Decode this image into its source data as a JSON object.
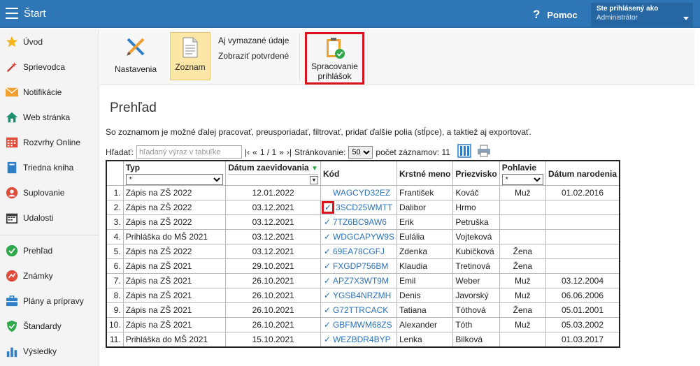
{
  "header": {
    "title": "Štart",
    "help_label": "Pomoc",
    "user_label": "Ste prihlásený ako",
    "user_name": "Administrátor"
  },
  "sidebar": {
    "items": [
      {
        "label": "Úvod",
        "icon": "star-icon"
      },
      {
        "label": "Sprievodca",
        "icon": "magic-wand-icon"
      },
      {
        "label": "Notifikácie",
        "icon": "envelope-icon"
      },
      {
        "label": "Web stránka",
        "icon": "house-icon"
      },
      {
        "label": "Rozvrhy Online",
        "icon": "timetable-icon"
      },
      {
        "label": "Triedna kniha",
        "icon": "book-icon"
      },
      {
        "label": "Suplovanie",
        "icon": "substitute-person-icon"
      },
      {
        "label": "Udalosti",
        "icon": "calendar-icon"
      },
      {
        "label": "Prehľad",
        "icon": "check-circle-icon"
      },
      {
        "label": "Známky",
        "icon": "grades-icon"
      },
      {
        "label": "Plány a prípravy",
        "icon": "briefcase-icon"
      },
      {
        "label": "Štandardy",
        "icon": "shield-check-icon"
      },
      {
        "label": "Výsledky",
        "icon": "bar-chart-icon"
      }
    ]
  },
  "toolbar": {
    "settings_label": "Nastavenia",
    "list_label": "Zoznam",
    "link_deleted": "Aj vymazané údaje",
    "link_confirmed": "Zobraziť potvrdené",
    "processing_line1": "Spracovanie",
    "processing_line2": "prihlášok"
  },
  "main": {
    "title": "Prehľad",
    "description": "So zoznamom je možné ďalej pracovať, preusporiadať, filtrovať, pridať ďalšie polia (stĺpce), a taktiež aj exportovať.",
    "search_label": "Hľadať:",
    "search_placeholder": "hľadaný výraz v tabuľke",
    "pager_first": "|‹",
    "pager_prev": "«",
    "pager_text": "1 / 1",
    "pager_next": "»",
    "pager_last": "›|",
    "page_size_label": "Stránkovanie:",
    "page_size_value": "50",
    "record_count_label": "počet záznamov: 11"
  },
  "table": {
    "headers": {
      "typ": "Typ",
      "datum": "Dátum zaevidovania",
      "kod": "Kód",
      "meno": "Krstné meno",
      "priezvisko": "Priezvisko",
      "pohlavie": "Pohlavie",
      "narodenie": "Dátum narodenia"
    },
    "filter_all": "*",
    "check_mark": "✓",
    "rows": [
      {
        "n": "1.",
        "typ": "Zápis na ZŠ 2022",
        "datum": "12.01.2022",
        "check": "",
        "kod": "WAGCYD32EZ",
        "meno": "František",
        "priezvisko": "Kováč",
        "pohlavie": "Muž",
        "narodenie": "01.02.2016"
      },
      {
        "n": "2.",
        "typ": "Zápis na ZŠ 2022",
        "datum": "03.12.2021",
        "check": "✓",
        "kod": "3SCD25WMTT",
        "meno": "Dalibor",
        "priezvisko": "Hrmo",
        "pohlavie": "",
        "narodenie": ""
      },
      {
        "n": "3.",
        "typ": "Zápis na ZŠ 2022",
        "datum": "03.12.2021",
        "check": "✓",
        "kod": "7TZ6BC9AW6",
        "meno": "Erik",
        "priezvisko": "Petruška",
        "pohlavie": "",
        "narodenie": ""
      },
      {
        "n": "4.",
        "typ": "Prihláška do MŠ 2021",
        "datum": "03.12.2021",
        "check": "✓",
        "kod": "WDGCAPYW9S",
        "meno": "Eulália",
        "priezvisko": "Vojteková",
        "pohlavie": "",
        "narodenie": ""
      },
      {
        "n": "5.",
        "typ": "Zápis na ZŠ 2022",
        "datum": "03.12.2021",
        "check": "✓",
        "kod": "69EA78CGFJ",
        "meno": "Zdenka",
        "priezvisko": "Kubičková",
        "pohlavie": "Žena",
        "narodenie": ""
      },
      {
        "n": "6.",
        "typ": "Zápis na ZŠ 2021",
        "datum": "29.10.2021",
        "check": "✓",
        "kod": "FXGDP756BM",
        "meno": "Klaudia",
        "priezvisko": "Tretinová",
        "pohlavie": "Žena",
        "narodenie": ""
      },
      {
        "n": "7.",
        "typ": "Zápis na ZŠ 2021",
        "datum": "26.10.2021",
        "check": "✓",
        "kod": "APZ7X3WT9M",
        "meno": "Emil",
        "priezvisko": "Weber",
        "pohlavie": "Muž",
        "narodenie": "03.12.2004"
      },
      {
        "n": "8.",
        "typ": "Zápis na ZŠ 2021",
        "datum": "26.10.2021",
        "check": "✓",
        "kod": "YGSB4NRZMH",
        "meno": "Denis",
        "priezvisko": "Javorský",
        "pohlavie": "Muž",
        "narodenie": "06.06.2006"
      },
      {
        "n": "9.",
        "typ": "Zápis na ZŠ 2021",
        "datum": "26.10.2021",
        "check": "✓",
        "kod": "G72TTRCACK",
        "meno": "Tatiana",
        "priezvisko": "Tóthová",
        "pohlavie": "Žena",
        "narodenie": "05.01.2001"
      },
      {
        "n": "10.",
        "typ": "Zápis na ZŠ 2021",
        "datum": "26.10.2021",
        "check": "✓",
        "kod": "GBFMWM68ZS",
        "meno": "Alexander",
        "priezvisko": "Tóth",
        "pohlavie": "Muž",
        "narodenie": "05.03.2002"
      },
      {
        "n": "11.",
        "typ": "Prihláška do MŠ 2021",
        "datum": "15.10.2021",
        "check": "✓",
        "kod": "WEZBDR4BYP",
        "meno": "Lenka",
        "priezvisko": "Bilková",
        "pohlavie": "",
        "narodenie": "01.03.2017"
      }
    ]
  },
  "colors": {
    "topbar": "#2f76b6",
    "highlight_red": "#d6141d",
    "link_blue": "#2e72b8",
    "active_button": "#fde7a7"
  }
}
